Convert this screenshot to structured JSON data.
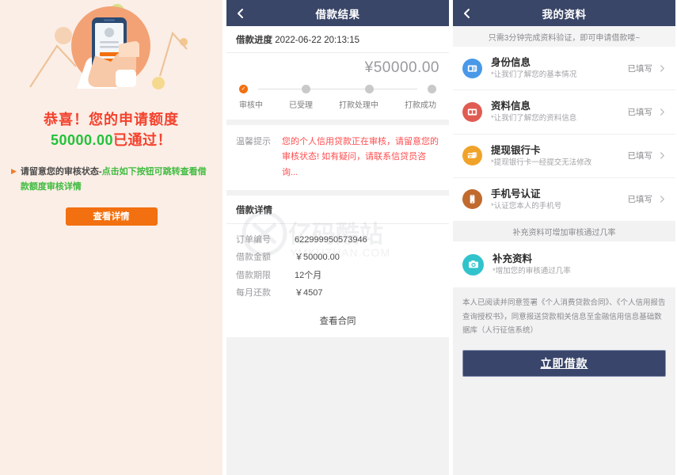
{
  "panel_approval": {
    "illustration_name": "hand-holding-phone-illustration",
    "congrats_line1": "恭喜！您的申请额度",
    "amount": "50000.00",
    "approved_suffix": "已通过！",
    "note_prefix": "请留意您的审核状态-",
    "note_highlight": "点击如下按钮可跳转查看借款额度审核详情",
    "detail_button": "查看详情",
    "colors": {
      "bg": "#fbeee6",
      "red": "#f4422e",
      "green": "#23c13a",
      "button": "#f2700f"
    }
  },
  "panel_result": {
    "header": {
      "title": "借款结果",
      "back_icon": "chevron-left-icon"
    },
    "progress_label": "借款进度",
    "progress_date": "2022-06-22 20:13:15",
    "amount": "¥50000.00",
    "steps": [
      {
        "label": "审核中",
        "active": true
      },
      {
        "label": "已受理",
        "active": false
      },
      {
        "label": "打款处理中",
        "active": false
      },
      {
        "label": "打款成功",
        "active": false
      }
    ],
    "tip_label": "温馨提示",
    "tip_text": "您的个人信用贷款正在审核，请留意您的审核状态! 如有疑问，请联系信贷员咨询...",
    "details_title": "借款详情",
    "details": [
      {
        "key": "订单编号",
        "value": "622999950573946"
      },
      {
        "key": "借款金额",
        "value": "￥50000.00"
      },
      {
        "key": "借款期限",
        "value": "12个月"
      },
      {
        "key": "每月还款",
        "value": "￥4507"
      }
    ],
    "contract_link": "查看合同",
    "watermark": {
      "cn": "亿码酷站",
      "en": "YMKUZHAN.COM"
    },
    "colors": {
      "header": "#3a4667",
      "accent": "#f2700f",
      "tip": "#ff4d4f"
    }
  },
  "panel_profile": {
    "header": {
      "title": "我的资料",
      "back_icon": "chevron-left-icon"
    },
    "subtitle": "只需3分钟完成资料验证，即可申请借款喽~",
    "items": [
      {
        "title": "身份信息",
        "subtitle": "*让我们了解您的基本情况",
        "status": "已填写",
        "icon": "id-card-icon",
        "color": "#4a98e8"
      },
      {
        "title": "资料信息",
        "subtitle": "*让我们了解您的资料信息",
        "status": "已填写",
        "icon": "document-card-icon",
        "color": "#e05c52"
      },
      {
        "title": "提现银行卡",
        "subtitle": "*提现银行卡一经提交无法修改",
        "status": "已填写",
        "icon": "bank-card-icon",
        "color": "#f0a32a"
      },
      {
        "title": "手机号认证",
        "subtitle": "*认证您本人的手机号",
        "status": "已填写",
        "icon": "mobile-phone-icon",
        "color": "#c06a2e"
      }
    ],
    "band_text": "补充资料可增加审核通过几率",
    "extra_item": {
      "title": "补充资料",
      "subtitle": "*增加您的审核通过几率",
      "icon": "camera-icon",
      "color": "#31c3cc"
    },
    "agreement": "本人已阅读并同意签署《个人消费贷款合同》、《个人信用报告查询授权书》，同意报送贷款相关信息至金融信用信息基础数据库（人行征信系统）",
    "loan_button": "立即借款",
    "colors": {
      "header": "#3a4667",
      "button": "#39456a"
    }
  }
}
